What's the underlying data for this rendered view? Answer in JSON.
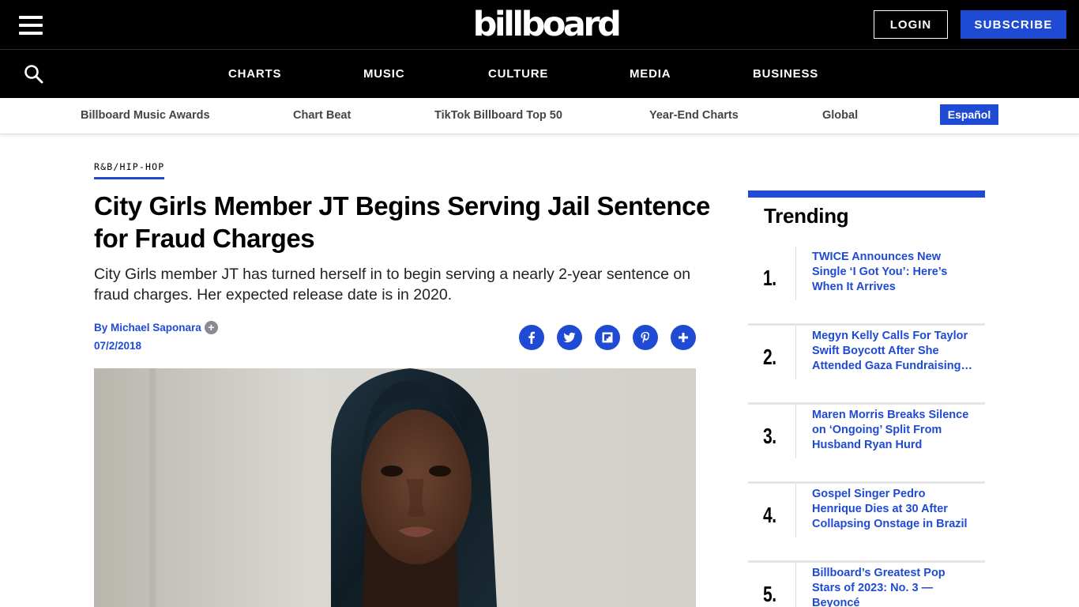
{
  "header": {
    "logo": "billboard",
    "login_label": "LOGIN",
    "subscribe_label": "SUBSCRIBE"
  },
  "nav": {
    "items": [
      "CHARTS",
      "MUSIC",
      "CULTURE",
      "MEDIA",
      "BUSINESS"
    ]
  },
  "subnav": {
    "items": [
      "Billboard Music Awards",
      "Chart Beat",
      "TikTok Billboard Top 50",
      "Year-End Charts",
      "Global"
    ],
    "espanol_label": "Español"
  },
  "article": {
    "category": "R&B/HIP-HOP",
    "headline": "City Girls Member JT Begins Serving Jail Sentence for Fraud Charges",
    "dek": "City Girls member JT has turned herself in to begin serving a nearly 2-year sentence on fraud charges. Her expected release date is in 2020.",
    "byline": "By Michael Saponara",
    "date": "07/2/2018"
  },
  "share": {
    "icons": [
      "facebook-icon",
      "twitter-icon",
      "flipboard-icon",
      "pinterest-icon",
      "plus-icon"
    ]
  },
  "trending": {
    "title": "Trending",
    "items": [
      {
        "num": "1.",
        "title": "TWICE Announces New Single ‘I Got You’: Here’s When It Arrives"
      },
      {
        "num": "2.",
        "title": "Megyn Kelly Calls For Taylor Swift Boycott After She Attended Gaza Fundraising…"
      },
      {
        "num": "3.",
        "title": "Maren Morris Breaks Silence on ‘Ongoing’ Split From Husband Ryan Hurd"
      },
      {
        "num": "4.",
        "title": "Gospel Singer Pedro Henrique Dies at 30 After Collapsing Onstage in Brazil"
      },
      {
        "num": "5.",
        "title": "Billboard’s Greatest Pop Stars of 2023: No. 3 — Beyoncé"
      }
    ]
  },
  "colors": {
    "brand_black": "#000000",
    "accent_blue": "#1f4ad4"
  }
}
